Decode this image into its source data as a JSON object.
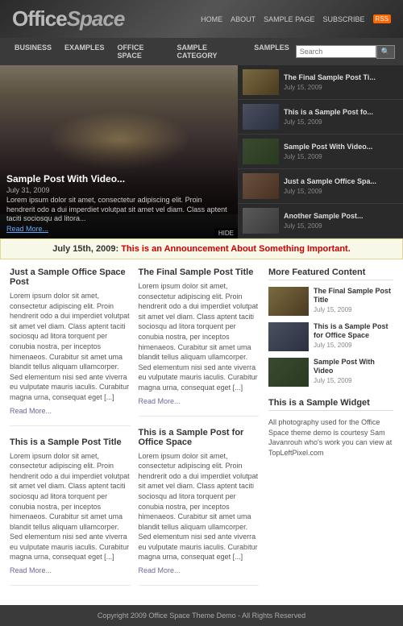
{
  "header": {
    "logo_part1": "Office",
    "logo_part2": "Space",
    "top_nav": [
      {
        "label": "HOME",
        "href": "#"
      },
      {
        "label": "ABOUT",
        "href": "#"
      },
      {
        "label": "SAMPLE PAGE",
        "href": "#"
      },
      {
        "label": "SUBSCRIBE",
        "href": "#"
      }
    ],
    "search_placeholder": "Search"
  },
  "main_nav": {
    "items": [
      {
        "label": "BUSINESS"
      },
      {
        "label": "EXAMPLES"
      },
      {
        "label": "OFFICE SPACE"
      },
      {
        "label": "SAMPLE CATEGORY"
      },
      {
        "label": "SAMPLES"
      }
    ]
  },
  "featured": {
    "main": {
      "title": "Sample Post With Video...",
      "date": "July 31, 2009",
      "excerpt": "Lorem ipsum dolor sit amet, consectetur adipiscing elit. Proin hendrerit odo a dui imperdiet volutpat sit amet vel diam. Class aptent taciti sociosqu ad litora...",
      "read_more": "Read More...",
      "hide_label": "HIDE"
    },
    "sidebar_posts": [
      {
        "title": "The Final Sample Post Ti...",
        "date": "July 15, 2009"
      },
      {
        "title": "This is a Sample Post fo...",
        "date": "July 15, 2009"
      },
      {
        "title": "Sample Post With Video...",
        "date": "July 15, 2009"
      },
      {
        "title": "Just a Sample Office Spa...",
        "date": "July 15, 2009"
      },
      {
        "title": "Another Sample Post...",
        "date": "July 15, 2009"
      }
    ]
  },
  "announcement": {
    "date": "July 15th, 2009:",
    "text": "This is an Announcement About Something Important."
  },
  "posts_left": [
    {
      "title": "Just a Sample Office Space Post",
      "body": "Lorem ipsum dolor sit amet, consectetur adipiscing elit. Proin hendrerit odo a dui imperdiet volutpat sit amet vel diam. Class aptent taciti sociosqu ad litora torquent per conubia nostra, per inceptos himenaeos. Curabitur sit amet uma blandit tellus aliquam ullamcorper. Sed elementum nisi sed ante viverra eu vulputate mauris iaculis. Curabitur magna urna, consequat eget [...]",
      "read_more": "Read More..."
    },
    {
      "title": "This is a Sample Post Title",
      "body": "Lorem ipsum dolor sit amet, consectetur adipiscing elit. Proin hendrerit odo a dui imperdiet volutpat sit amet vel diam. Class aptent taciti sociosqu ad litora torquent per conubia nostra, per inceptos himenaeos. Curabitur sit amet uma blandit tellus aliquam ullamcorper. Sed elementum nisi sed ante viverra eu vulputate mauris iaculis. Curabitur magna urna, consequat eget [...]",
      "read_more": "Read More..."
    }
  ],
  "posts_right": [
    {
      "title": "The Final Sample Post Title",
      "body": "Lorem ipsum dolor sit amet, consectetur adipiscing elit. Proin hendrerit odo a dui imperdiet volutpat sit amet vel diam. Class aptent taciti sociosqu ad litora torquent per conubia nostra, per inceptos himenaeos. Curabitur sit amet uma blandit tellus aliquam ullamcorper. Sed elementum nisi sed ante viverra eu vulputate mauris iaculis. Curabitur magna urna, consequat eget [...]",
      "read_more": "Read More..."
    },
    {
      "title": "This is a Sample Post for Office Space",
      "body": "Lorem ipsum dolor sit amet, consectetur adipiscing elit. Proin hendrerit odo a dui imperdiet volutpat sit amet vel diam. Class aptent taciti sociosqu ad litora torquent per conubia nostra, per inceptos himenaeos. Curabitur sit amet uma blandit tellus aliquam ullamcorper. Sed elementum nisi sed ante viverra eu vulputate mauris iaculis. Curabitur magna urna, consequat eget [...]",
      "read_more": "Read More..."
    }
  ],
  "sidebar": {
    "section_title": "More Featured Content",
    "posts": [
      {
        "title": "The Final Sample Post Title",
        "date": "July 15, 2009"
      },
      {
        "title": "This is a Sample Post for Office Space",
        "date": "July 15, 2009"
      },
      {
        "title": "Sample Post With Video",
        "date": "July 15, 2009"
      }
    ],
    "widget_title": "This is a Sample Widget",
    "widget_text": "All photography used for the Office Space theme demo is courtesy Sam Javanrouh who's work you can view at TopLeftPixel.com"
  },
  "footer": {
    "text": "Copyright 2009 Office Space Theme Demo - All Rights Reserved"
  }
}
